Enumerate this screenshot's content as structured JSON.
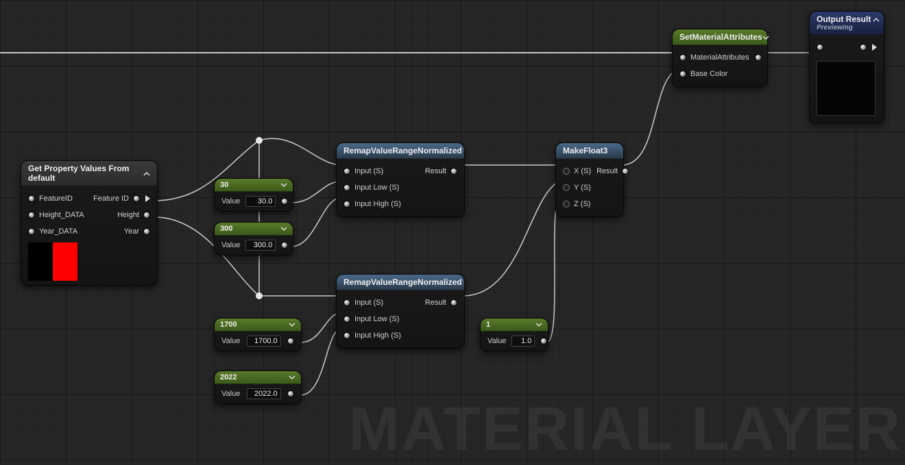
{
  "watermark": "MATERIAL LAYER",
  "nodes": {
    "getProps": {
      "title": "Get Property Values From default",
      "inputs": [
        "FeatureID",
        "Height_DATA",
        "Year_DATA"
      ],
      "outputs": [
        "Feature ID",
        "Height",
        "Year"
      ],
      "swatches": [
        "#000000",
        "#ff0000"
      ]
    },
    "const30": {
      "title": "30",
      "valueLabel": "Value",
      "value": "30.0"
    },
    "const300": {
      "title": "300",
      "valueLabel": "Value",
      "value": "300.0"
    },
    "const1700": {
      "title": "1700",
      "valueLabel": "Value",
      "value": "1700.0"
    },
    "const2022": {
      "title": "2022",
      "valueLabel": "Value",
      "value": "2022.0"
    },
    "const1": {
      "title": "1",
      "valueLabel": "Value",
      "value": "1.0"
    },
    "remap1": {
      "title": "RemapValueRangeNormalized",
      "inputs": [
        "Input (S)",
        "Input Low (S)",
        "Input High (S)"
      ],
      "output": "Result"
    },
    "remap2": {
      "title": "RemapValueRangeNormalized",
      "inputs": [
        "Input (S)",
        "Input Low (S)",
        "Input High (S)"
      ],
      "output": "Result"
    },
    "makeFloat3": {
      "title": "MakeFloat3",
      "inputs": [
        "X (S)",
        "Y (S)",
        "Z (S)"
      ],
      "output": "Result"
    },
    "setMatAttr": {
      "title": "SetMaterialAttributes",
      "rows": [
        "MaterialAttributes",
        "Base Color"
      ]
    },
    "outputResult": {
      "title": "Output Result",
      "subtitle": "Previewing"
    }
  }
}
